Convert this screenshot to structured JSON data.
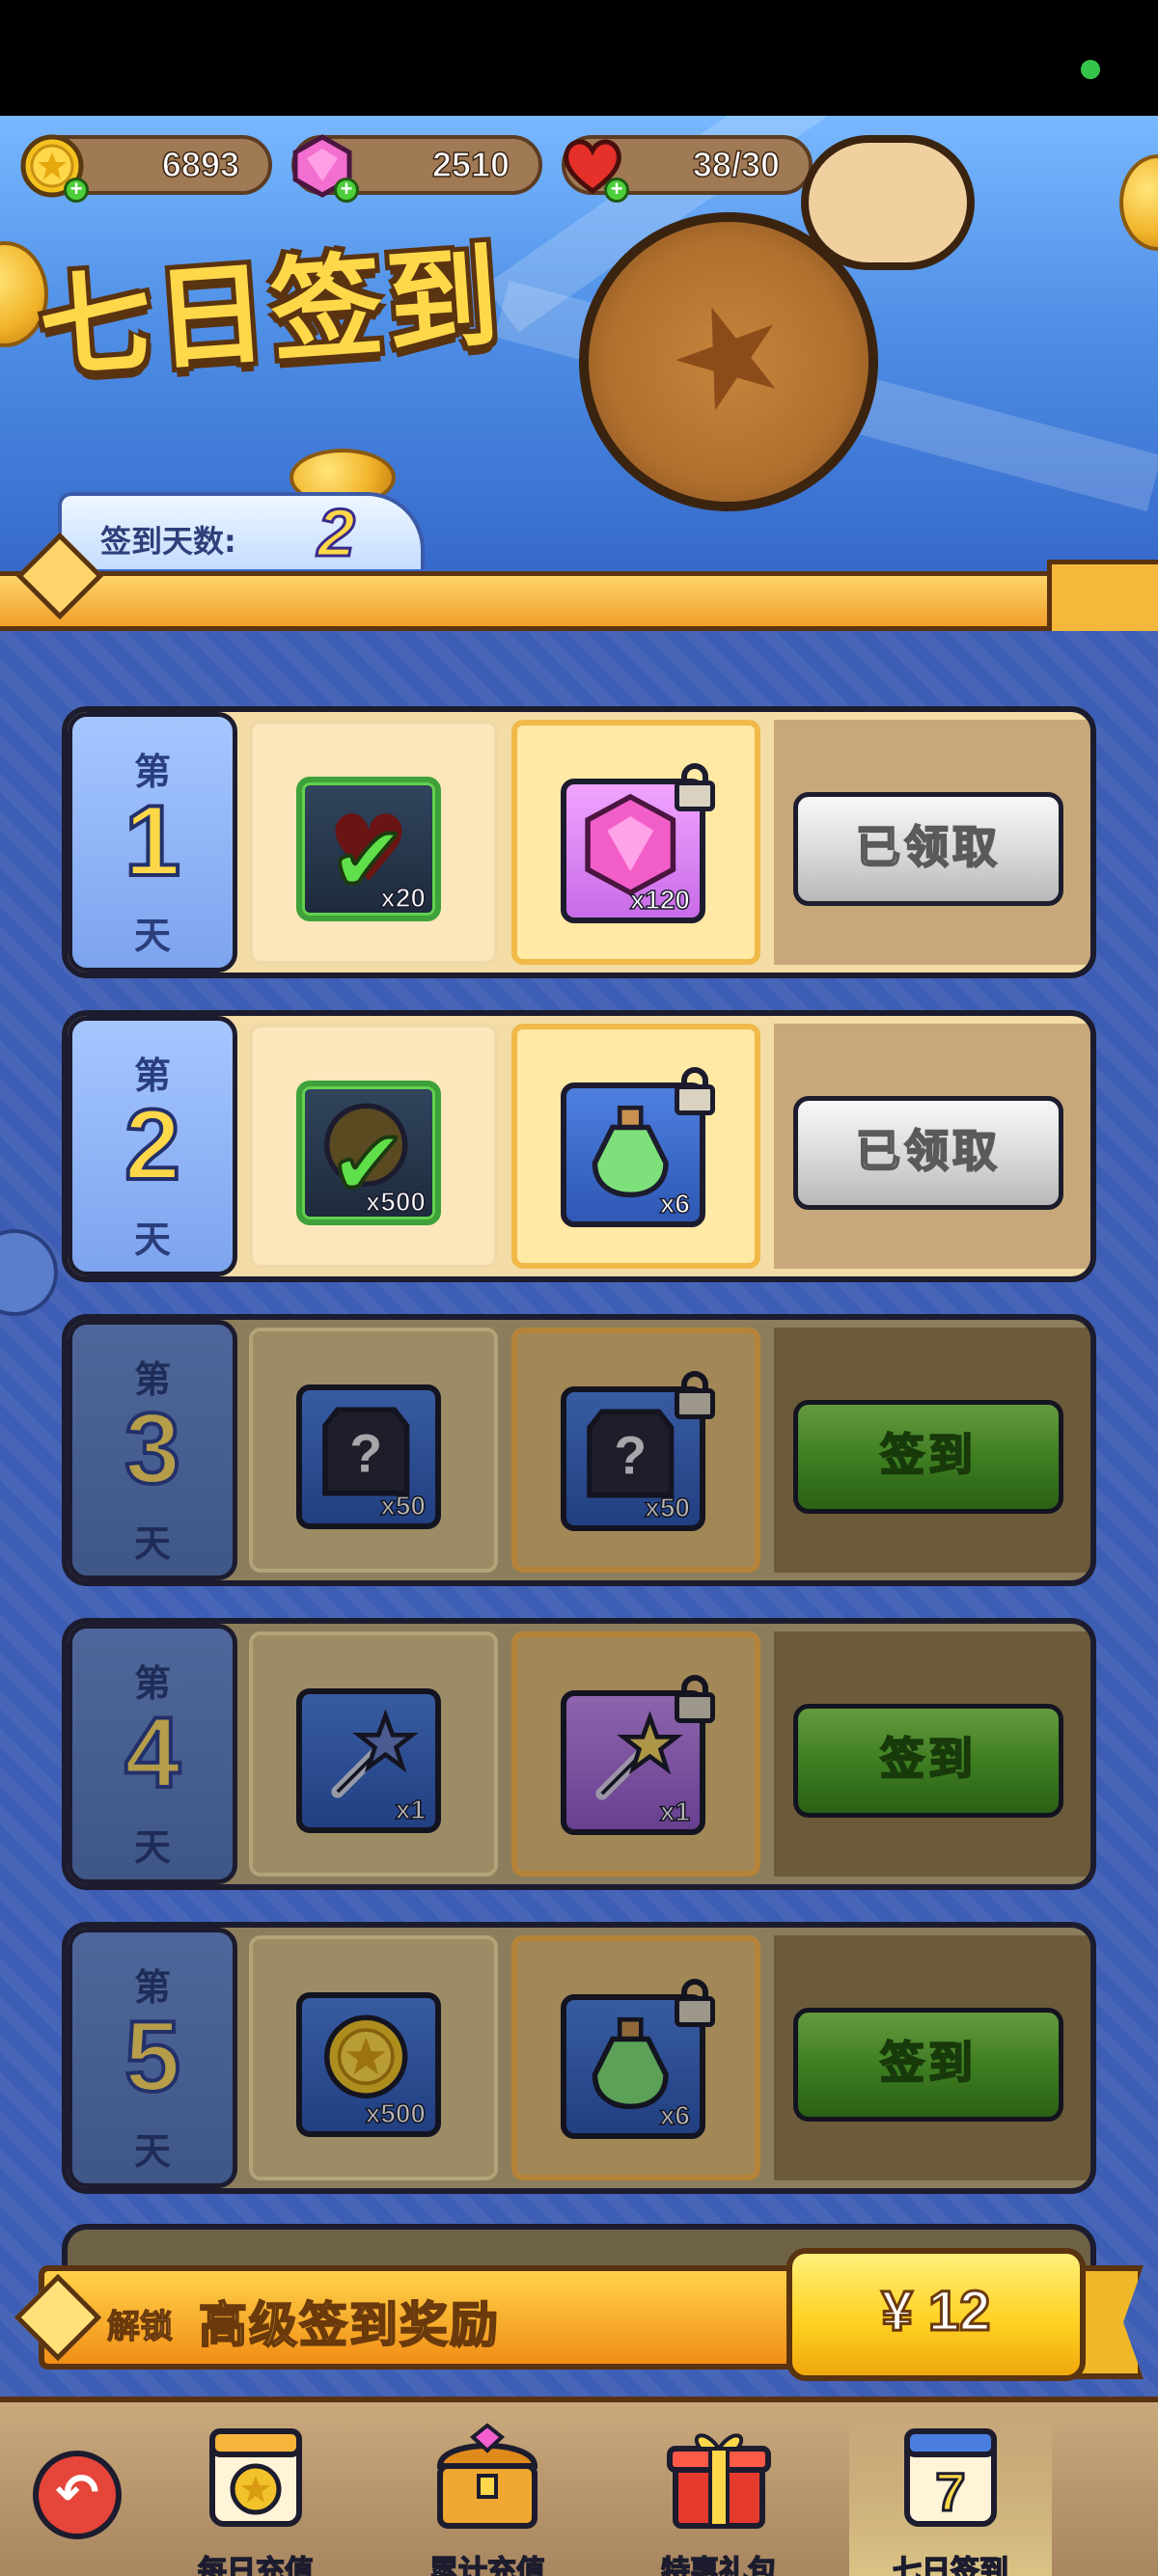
{
  "resources": {
    "coins": "6893",
    "gems": "2510",
    "hearts": "38/30"
  },
  "banner": {
    "title": "七日签到",
    "days_label": "签到天数:",
    "days_value": "2"
  },
  "rows": [
    {
      "pre": "第",
      "num": "1",
      "post": "天",
      "free_qty": "x20",
      "premium_qty": "x120",
      "button": "已领取"
    },
    {
      "pre": "第",
      "num": "2",
      "post": "天",
      "free_qty": "x500",
      "premium_qty": "x6",
      "button": "已领取"
    },
    {
      "pre": "第",
      "num": "3",
      "post": "天",
      "free_qty": "x50",
      "premium_qty": "x50",
      "button": "签到"
    },
    {
      "pre": "第",
      "num": "4",
      "post": "天",
      "free_qty": "x1",
      "premium_qty": "x1",
      "button": "签到"
    },
    {
      "pre": "第",
      "num": "5",
      "post": "天",
      "free_qty": "x500",
      "premium_qty": "x6",
      "button": "签到"
    }
  ],
  "unlock": {
    "label": "解锁",
    "title": "高级签到奖励",
    "price": "¥ 12"
  },
  "nav": {
    "items": [
      {
        "label": "每日充值",
        "icon": "calendar-coin-icon"
      },
      {
        "label": "累计充值",
        "icon": "treasure-chest-icon"
      },
      {
        "label": "特惠礼包",
        "icon": "gift-box-icon"
      },
      {
        "label": "七日签到",
        "icon": "calendar-7-icon"
      }
    ]
  },
  "colors": {
    "accent": "#ffd84a",
    "main_bg": "#3d5eb4",
    "sign_button": "#56b02e",
    "claimed_button": "#d8d8d8"
  }
}
